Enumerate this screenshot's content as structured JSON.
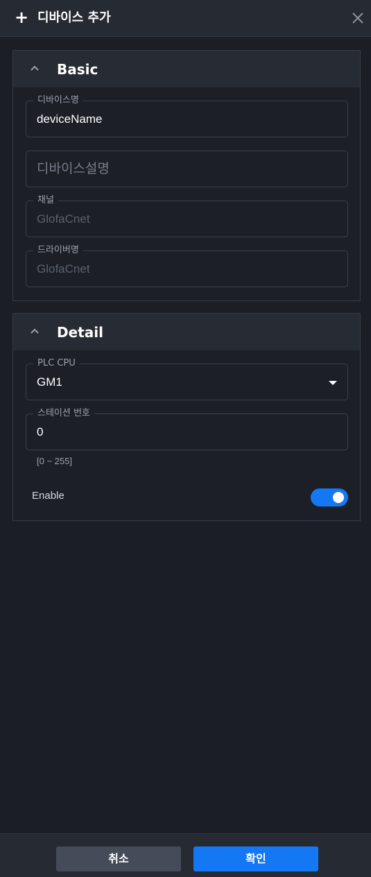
{
  "header": {
    "title": "디바이스 추가",
    "plus_icon": "plus-icon",
    "close_icon": "close-icon"
  },
  "basic": {
    "title": "Basic",
    "device_name": {
      "label": "디바이스명",
      "value": "deviceName"
    },
    "device_description": {
      "placeholder": "디바이스설명"
    },
    "channel": {
      "label": "채널",
      "value": "GlofaCnet"
    },
    "driver_name": {
      "label": "드라이버명",
      "value": "GlofaCnet"
    }
  },
  "detail": {
    "title": "Detail",
    "plc_cpu": {
      "label": "PLC CPU",
      "value": "GM1"
    },
    "station_number": {
      "label": "스테이션 번호",
      "value": "0",
      "hint": "[0 ~ 255]"
    },
    "enable": {
      "label": "Enable",
      "on": true
    }
  },
  "footer": {
    "cancel_label": "취소",
    "ok_label": "확인"
  },
  "colors": {
    "accent": "#1478f5",
    "background": "#1b1e25",
    "panel_header": "#272b34"
  }
}
